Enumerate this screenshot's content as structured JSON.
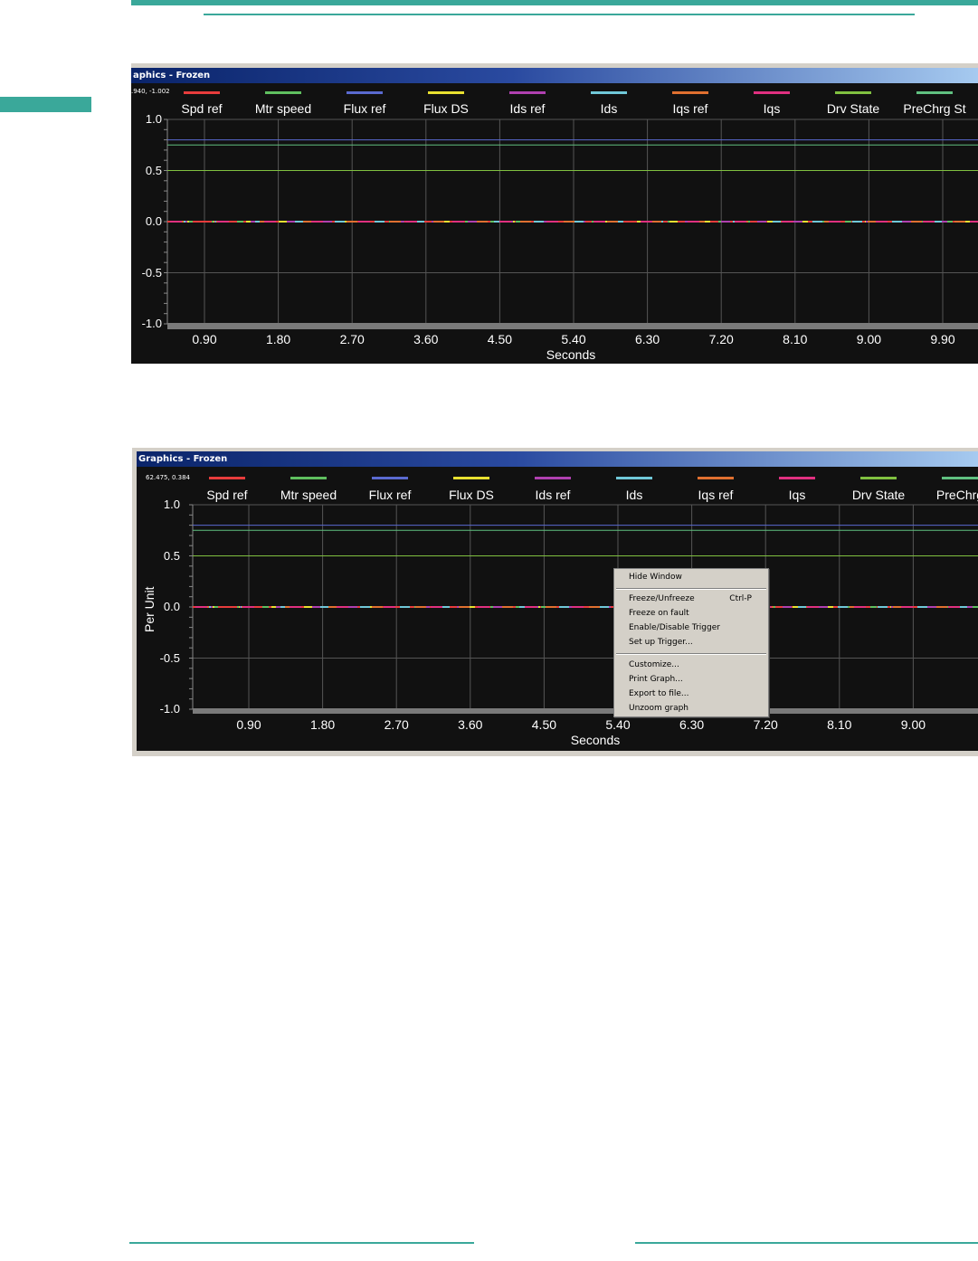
{
  "windows": [
    {
      "title": "aphics - Frozen",
      "cursor_readout": ".940, -1.002",
      "ylabel": "",
      "xlabel": "Seconds",
      "legend": [
        {
          "label": "Spd ref",
          "color": "#e83c3c"
        },
        {
          "label": "Mtr speed",
          "color": "#5fbf5f"
        },
        {
          "label": "Flux ref",
          "color": "#5a6ad0"
        },
        {
          "label": "Flux DS",
          "color": "#e8e030"
        },
        {
          "label": "Ids ref",
          "color": "#b040b0"
        },
        {
          "label": "Ids",
          "color": "#70c8d8"
        },
        {
          "label": "Iqs ref",
          "color": "#e07030"
        },
        {
          "label": "Iqs",
          "color": "#e03080"
        },
        {
          "label": "Drv State",
          "color": "#80c040"
        },
        {
          "label": "PreChrg St",
          "color": "#60c080"
        }
      ],
      "yticks": [
        "1.0",
        "0.5",
        "0.0",
        "-0.5",
        "-1.0"
      ],
      "xticks": [
        "0.90",
        "1.80",
        "2.70",
        "3.60",
        "4.50",
        "5.40",
        "6.30",
        "7.20",
        "8.10",
        "9.00",
        "9.90"
      ]
    },
    {
      "title": "Graphics - Frozen",
      "cursor_readout": "62.475, 0.384",
      "ylabel": "Per Unit",
      "xlabel": "Seconds",
      "legend": [
        {
          "label": "Spd ref",
          "color": "#e83c3c"
        },
        {
          "label": "Mtr speed",
          "color": "#5fbf5f"
        },
        {
          "label": "Flux ref",
          "color": "#5a6ad0"
        },
        {
          "label": "Flux DS",
          "color": "#e8e030"
        },
        {
          "label": "Ids ref",
          "color": "#b040b0"
        },
        {
          "label": "Ids",
          "color": "#70c8d8"
        },
        {
          "label": "Iqs ref",
          "color": "#e07030"
        },
        {
          "label": "Iqs",
          "color": "#e03080"
        },
        {
          "label": "Drv State",
          "color": "#80c040"
        },
        {
          "label": "PreChrg",
          "color": "#60c080"
        }
      ],
      "yticks": [
        "1.0",
        "0.5",
        "0.0",
        "-0.5",
        "-1.0"
      ],
      "xticks": [
        "0.90",
        "1.80",
        "2.70",
        "3.60",
        "4.50",
        "5.40",
        "6.30",
        "7.20",
        "8.10",
        "9.00"
      ]
    }
  ],
  "context_menu": {
    "items": [
      {
        "label": "Hide Window",
        "shortcut": ""
      },
      {
        "label": "Freeze/Unfreeze",
        "shortcut": "Ctrl-P"
      },
      {
        "label": "Freeze on fault",
        "shortcut": ""
      },
      {
        "label": "Enable/Disable Trigger",
        "shortcut": ""
      },
      {
        "label": "Set up Trigger...",
        "shortcut": ""
      },
      {
        "label": "Customize...",
        "shortcut": ""
      },
      {
        "label": "Print Graph...",
        "shortcut": ""
      },
      {
        "label": "Export to file...",
        "shortcut": ""
      },
      {
        "label": "Unzoom graph",
        "shortcut": ""
      }
    ]
  },
  "chart_data": [
    {
      "type": "line",
      "xlabel": "Seconds",
      "ylabel": "",
      "ylim": [
        -1.0,
        1.0
      ],
      "xlim": [
        0.0,
        9.9
      ],
      "grid": true,
      "legend_position": "top",
      "x_ticks": [
        0.9,
        1.8,
        2.7,
        3.6,
        4.5,
        5.4,
        6.3,
        7.2,
        8.1,
        9.0,
        9.9
      ],
      "series": [
        {
          "name": "Spd ref",
          "level": 0.0
        },
        {
          "name": "Mtr speed",
          "level": 0.0
        },
        {
          "name": "Flux ref",
          "level": 0.8
        },
        {
          "name": "Flux DS",
          "level": 0.0
        },
        {
          "name": "Ids ref",
          "level": 0.0
        },
        {
          "name": "Ids",
          "level": 0.0
        },
        {
          "name": "Iqs ref",
          "level": 0.0
        },
        {
          "name": "Iqs",
          "level": 0.0
        },
        {
          "name": "Drv State",
          "level": 0.5
        },
        {
          "name": "PreChrg St",
          "level": 0.75
        }
      ]
    },
    {
      "type": "line",
      "xlabel": "Seconds",
      "ylabel": "Per Unit",
      "ylim": [
        -1.0,
        1.0
      ],
      "xlim": [
        0.0,
        9.9
      ],
      "grid": true,
      "legend_position": "top",
      "x_ticks": [
        0.9,
        1.8,
        2.7,
        3.6,
        4.5,
        5.4,
        6.3,
        7.2,
        8.1,
        9.0
      ],
      "series": [
        {
          "name": "Spd ref",
          "level": 0.0
        },
        {
          "name": "Mtr speed",
          "level": 0.0
        },
        {
          "name": "Flux ref",
          "level": 0.8
        },
        {
          "name": "Flux DS",
          "level": 0.0
        },
        {
          "name": "Ids ref",
          "level": 0.0
        },
        {
          "name": "Ids",
          "level": 0.0
        },
        {
          "name": "Iqs ref",
          "level": 0.0
        },
        {
          "name": "Iqs",
          "level": 0.0
        },
        {
          "name": "Drv State",
          "level": 0.5
        },
        {
          "name": "PreChrg",
          "level": 0.75
        }
      ]
    }
  ]
}
